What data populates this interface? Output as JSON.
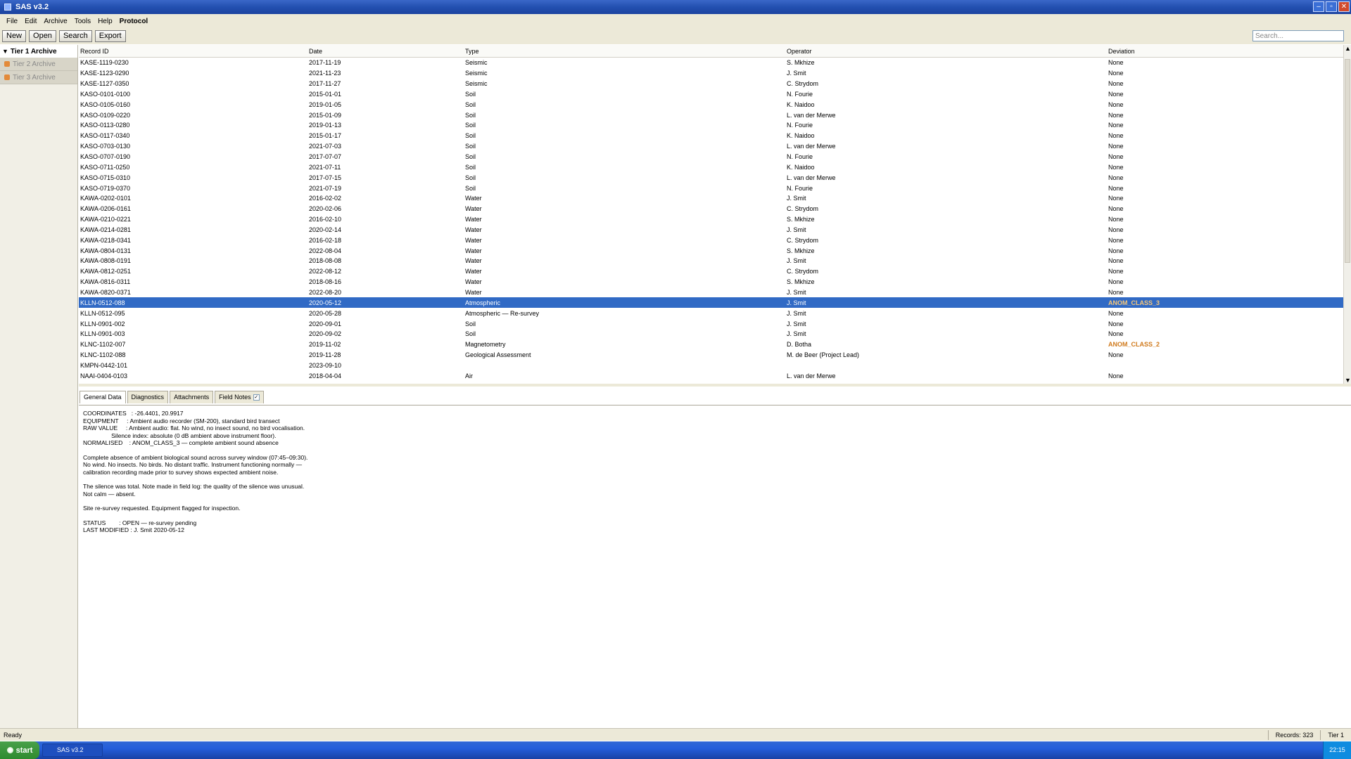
{
  "window": {
    "title": "SAS v3.2"
  },
  "menu": [
    "File",
    "Edit",
    "Archive",
    "Tools",
    "Help",
    "Protocol"
  ],
  "toolbar": {
    "buttons": [
      "New",
      "Open",
      "Search",
      "Export"
    ],
    "search_placeholder": "Search..."
  },
  "sidebar": {
    "root": "Tier 1 Archive",
    "items": [
      "Tier 2 Archive",
      "Tier 3 Archive"
    ]
  },
  "table": {
    "headers": [
      "Record ID",
      "Date",
      "Type",
      "Operator",
      "Deviation"
    ],
    "rows": [
      [
        "KASE-1119-0230",
        "2017-11-19",
        "Seismic",
        "S. Mkhize",
        "None"
      ],
      [
        "KASE-1123-0290",
        "2021-11-23",
        "Seismic",
        "J. Smit",
        "None"
      ],
      [
        "KASE-1127-0350",
        "2017-11-27",
        "Seismic",
        "C. Strydom",
        "None"
      ],
      [
        "KASO-0101-0100",
        "2015-01-01",
        "Soil",
        "N. Fourie",
        "None"
      ],
      [
        "KASO-0105-0160",
        "2019-01-05",
        "Soil",
        "K. Naidoo",
        "None"
      ],
      [
        "KASO-0109-0220",
        "2015-01-09",
        "Soil",
        "L. van der Merwe",
        "None"
      ],
      [
        "KASO-0113-0280",
        "2019-01-13",
        "Soil",
        "N. Fourie",
        "None"
      ],
      [
        "KASO-0117-0340",
        "2015-01-17",
        "Soil",
        "K. Naidoo",
        "None"
      ],
      [
        "KASO-0703-0130",
        "2021-07-03",
        "Soil",
        "L. van der Merwe",
        "None"
      ],
      [
        "KASO-0707-0190",
        "2017-07-07",
        "Soil",
        "N. Fourie",
        "None"
      ],
      [
        "KASO-0711-0250",
        "2021-07-11",
        "Soil",
        "K. Naidoo",
        "None"
      ],
      [
        "KASO-0715-0310",
        "2017-07-15",
        "Soil",
        "L. van der Merwe",
        "None"
      ],
      [
        "KASO-0719-0370",
        "2021-07-19",
        "Soil",
        "N. Fourie",
        "None"
      ],
      [
        "KAWA-0202-0101",
        "2016-02-02",
        "Water",
        "J. Smit",
        "None"
      ],
      [
        "KAWA-0206-0161",
        "2020-02-06",
        "Water",
        "C. Strydom",
        "None"
      ],
      [
        "KAWA-0210-0221",
        "2016-02-10",
        "Water",
        "S. Mkhize",
        "None"
      ],
      [
        "KAWA-0214-0281",
        "2020-02-14",
        "Water",
        "J. Smit",
        "None"
      ],
      [
        "KAWA-0218-0341",
        "2016-02-18",
        "Water",
        "C. Strydom",
        "None"
      ],
      [
        "KAWA-0804-0131",
        "2022-08-04",
        "Water",
        "S. Mkhize",
        "None"
      ],
      [
        "KAWA-0808-0191",
        "2018-08-08",
        "Water",
        "J. Smit",
        "None"
      ],
      [
        "KAWA-0812-0251",
        "2022-08-12",
        "Water",
        "C. Strydom",
        "None"
      ],
      [
        "KAWA-0816-0311",
        "2018-08-16",
        "Water",
        "S. Mkhize",
        "None"
      ],
      [
        "KAWA-0820-0371",
        "2022-08-20",
        "Water",
        "J. Smit",
        "None"
      ],
      [
        "KLLN-0512-088",
        "2020-05-12",
        "Atmospheric",
        "J. Smit",
        "ANOM_CLASS_3"
      ],
      [
        "KLLN-0512-095",
        "2020-05-28",
        "Atmospheric — Re-survey",
        "J. Smit",
        "None"
      ],
      [
        "KLLN-0901-002",
        "2020-09-01",
        "Soil",
        "J. Smit",
        "None"
      ],
      [
        "KLLN-0901-003",
        "2020-09-02",
        "Soil",
        "J. Smit",
        "None"
      ],
      [
        "KLNC-1102-007",
        "2019-11-02",
        "Magnetometry",
        "D. Botha",
        "ANOM_CLASS_2"
      ],
      [
        "KLNC-1102-088",
        "2019-11-28",
        "Geological Assessment",
        "M. de Beer (Project Lead)",
        "None"
      ],
      [
        "KMPN-0442-101",
        "2023-09-10",
        "",
        "",
        ""
      ],
      [
        "NAAI-0404-0103",
        "2018-04-04",
        "Air",
        "L. van der Merwe",
        "None"
      ]
    ],
    "selected_index": 23
  },
  "tabs": [
    "General Data",
    "Diagnostics",
    "Attachments",
    "Field Notes"
  ],
  "details": {
    "lines": [
      "COORDINATES   : -26.4401, 20.9917",
      "EQUIPMENT     : Ambient audio recorder (SM-200), standard bird transect",
      "RAW VALUE     : Ambient audio: flat. No wind, no insect sound, no bird vocalisation.",
      "                 Silence index: absolute (0 dB ambient above instrument floor).",
      "NORMALISED    : ANOM_CLASS_3 — complete ambient sound absence",
      "",
      "Complete absence of ambient biological sound across survey window (07:45–09:30).",
      "No wind. No insects. No birds. No distant traffic. Instrument functioning normally —",
      "calibration recording made prior to survey shows expected ambient noise.",
      "",
      "The silence was total. Note made in field log: the quality of the silence was unusual.",
      "Not calm — absent.",
      "",
      "Site re-survey requested. Equipment flagged for inspection.",
      "",
      "STATUS        : OPEN — re-survey pending",
      "LAST MODIFIED : J. Smit 2020-05-12"
    ]
  },
  "status": {
    "left": "Ready",
    "records": "Records: 323",
    "tier": "Tier 1"
  },
  "taskbar": {
    "start": "start",
    "task": "SAS v3.2",
    "clock": "22:15"
  },
  "colors": {
    "selection": "#316ac5",
    "anomaly": "#d07a1c",
    "titlebar": "#2350b0"
  }
}
